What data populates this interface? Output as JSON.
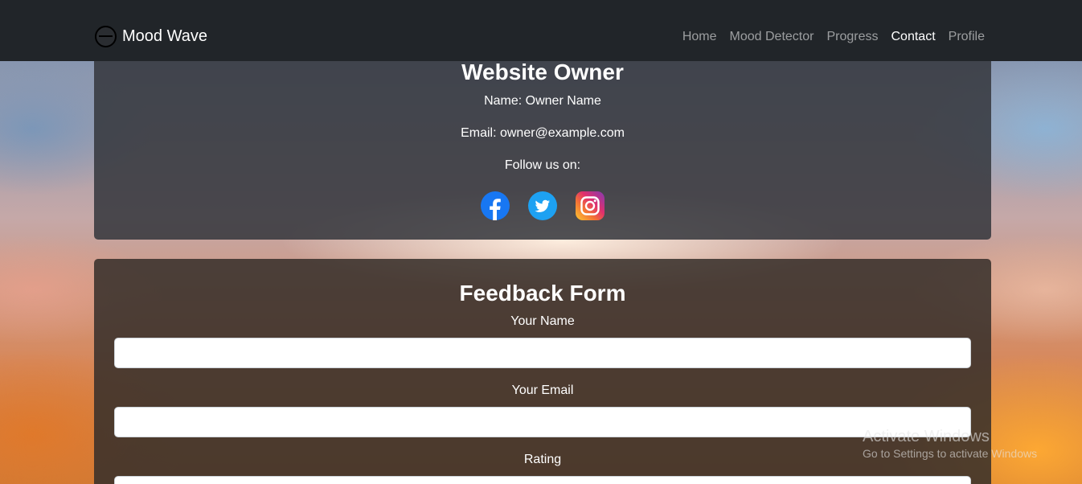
{
  "navbar": {
    "brand": "Mood Wave",
    "links": [
      {
        "label": "Home",
        "active": false
      },
      {
        "label": "Mood Detector",
        "active": false
      },
      {
        "label": "Progress",
        "active": false
      },
      {
        "label": "Contact",
        "active": true
      },
      {
        "label": "Profile",
        "active": false
      }
    ]
  },
  "owner": {
    "title": "Website Owner",
    "name_line": "Name: Owner Name",
    "email_line": "Email: owner@example.com",
    "follow_label": "Follow us on:",
    "socials": [
      "facebook-icon",
      "twitter-icon",
      "instagram-icon"
    ]
  },
  "feedback": {
    "title": "Feedback Form",
    "name_label": "Your Name",
    "name_value": "",
    "email_label": "Your Email",
    "email_value": "",
    "rating_label": "Rating"
  },
  "watermark": {
    "title": "Activate Windows",
    "subtitle": "Go to Settings to activate Windows"
  },
  "colors": {
    "navbar": "#212529",
    "facebook": "#1877F2",
    "twitter": "#1DA1F2"
  }
}
